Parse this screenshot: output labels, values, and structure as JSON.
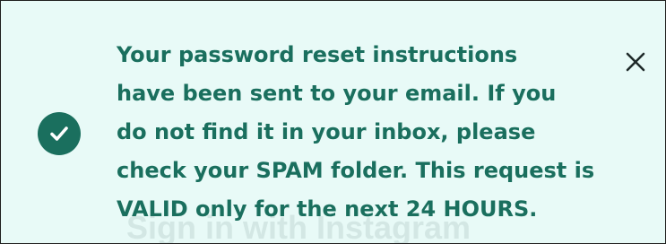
{
  "toast": {
    "message_lines": [
      "Your password reset instructions",
      "have been sent to your email. If you",
      "do not find it in your inbox, please",
      "check your SPAM folder. This request is",
      "VALID only for the next 24 HOURS."
    ],
    "icon": "check-circle-icon",
    "close_icon": "close-icon",
    "background_color": "#e8faf7",
    "accent_color": "#1a6f5e"
  },
  "behind": {
    "obscured_text": "Sign in with Instagram"
  }
}
